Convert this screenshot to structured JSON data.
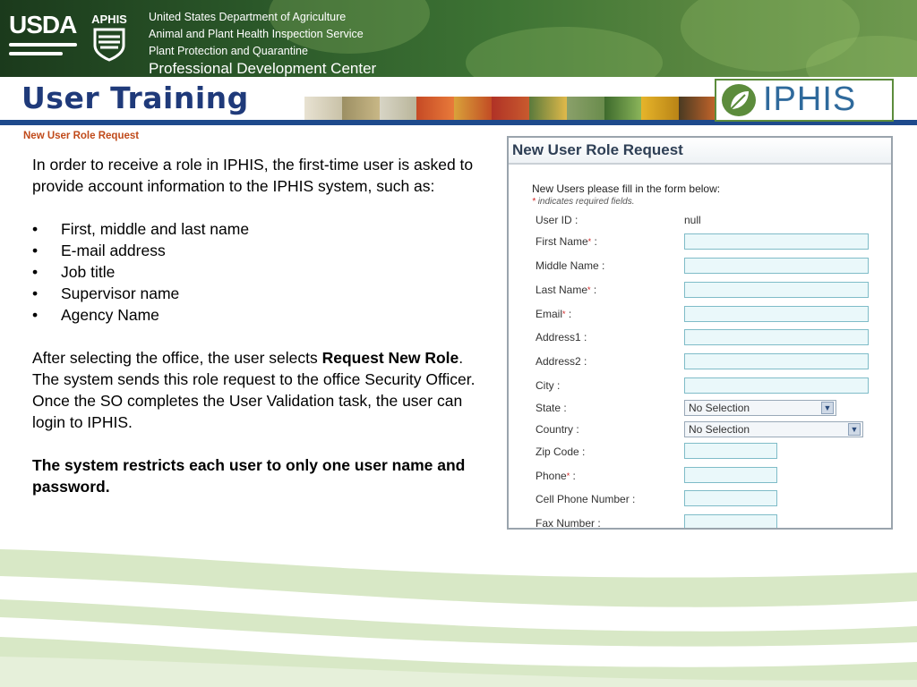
{
  "header": {
    "org_line1": "United States Department of Agriculture",
    "org_line2": "Animal and Plant Health Inspection Service",
    "org_line3": "Plant Protection and Quarantine",
    "org_line4": "Professional Development Center",
    "usda_logo_text": "USDA",
    "aphis_logo_text": "APHIS"
  },
  "banner": {
    "title": "User Training",
    "product_logo_text": "IPHIS"
  },
  "subtitle": "New User Role Request",
  "content": {
    "intro": "In order to receive a role in IPHIS, the first-time user is asked to provide account information to the IPHIS system, such as:",
    "bullets": [
      "First, middle and last name",
      "E-mail address",
      "Job title",
      "Supervisor name",
      "Agency Name"
    ],
    "para2_prefix": "After selecting the office, the user selects ",
    "para2_bold": "Request New Role",
    "para2_suffix": ". The system sends this role request to the office Security Officer. Once the SO completes the User Validation task, the user can login to IPHIS.",
    "restriction": "The system restricts each user to only one user name and password."
  },
  "form": {
    "title": "New User Role Request",
    "intro": "New Users please fill in the form below:",
    "required_note": "indicates required fields.",
    "required_marker": "*",
    "user_id_label": "User ID :",
    "user_id_value": "null",
    "fields": [
      {
        "label": "First Name",
        "required": true
      },
      {
        "label": "Middle Name",
        "required": false
      },
      {
        "label": "Last Name",
        "required": true
      },
      {
        "label": "Email",
        "required": true
      },
      {
        "label": "Address1",
        "required": false
      },
      {
        "label": "Address2",
        "required": false
      },
      {
        "label": "City",
        "required": false
      }
    ],
    "state_label": "State :",
    "state_value": "No Selection",
    "country_label": "Country :",
    "country_value": "No Selection",
    "zip_label": "Zip Code :",
    "phone_label": "Phone",
    "cell_label": "Cell Phone Number :",
    "fax_label": "Fax Number :"
  },
  "colors": {
    "title_blue": "#1f3a7a",
    "subtitle_orange": "#c04a1a",
    "field_border": "#7fbcc8",
    "required_red": "#d02020"
  }
}
